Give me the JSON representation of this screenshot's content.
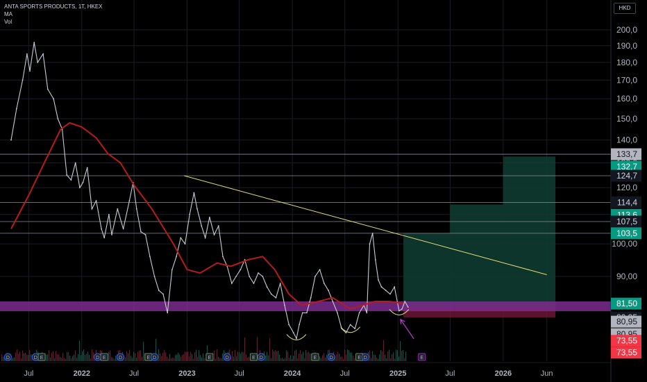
{
  "legend": {
    "symbol": "ANTA SPORTS PRODUCTS, 1T, HKEX",
    "ma": "MA",
    "vol": "Vol"
  },
  "currency_button": "HKD",
  "colors": {
    "background": "#000000",
    "price_line": "#c9cdd6",
    "ma_line": "#b71c1c",
    "trendline": "#e8e07a",
    "purple_band": "#7b2d8e",
    "pink_band": "#7a1a3a",
    "target_box": "#0f3b30",
    "grid": "#1c1e24",
    "up_tag": "#089981",
    "down_tag": "#f23645",
    "gray_tag": "#b2b5be",
    "arrow": "#c23cdb"
  },
  "chart_data": {
    "type": "line",
    "title": "ANTA SPORTS PRODUCTS, 1T, HKEX",
    "y_axis": {
      "scale": "log",
      "ticks": [
        90.0,
        100.0,
        110.0,
        120.0,
        130.0,
        140.0,
        150.0,
        160.0,
        170.0,
        180.0,
        190.0,
        200.0
      ],
      "tick_labels": [
        "90,00",
        "100,00",
        "110,0",
        "120,0",
        "130,0",
        "140,0",
        "150,0",
        "160,0",
        "170,0",
        "180,0",
        "190,0",
        "200,0"
      ]
    },
    "x_axis": {
      "range": [
        "2021-05-01",
        "2026-08-01"
      ],
      "ticks": [
        {
          "date": "2021-07-01",
          "label": "Jul",
          "bold": false
        },
        {
          "date": "2022-01-01",
          "label": "2022",
          "bold": true
        },
        {
          "date": "2022-07-01",
          "label": "Jul",
          "bold": false
        },
        {
          "date": "2023-01-01",
          "label": "2023",
          "bold": true
        },
        {
          "date": "2023-07-01",
          "label": "Jul",
          "bold": false
        },
        {
          "date": "2024-01-01",
          "label": "2024",
          "bold": true
        },
        {
          "date": "2024-07-01",
          "label": "Jul",
          "bold": false
        },
        {
          "date": "2025-01-01",
          "label": "2025",
          "bold": true
        },
        {
          "date": "2025-07-01",
          "label": "Jul",
          "bold": false
        },
        {
          "date": "2026-01-01",
          "label": "2026",
          "bold": true
        },
        {
          "date": "2026-06-01",
          "label": "Jun",
          "bold": false
        }
      ]
    },
    "series": [
      {
        "kind": "price",
        "points": [
          [
            "2021-05-01",
            140
          ],
          [
            "2021-05-20",
            155
          ],
          [
            "2021-06-10",
            170
          ],
          [
            "2021-06-25",
            185
          ],
          [
            "2021-07-05",
            175
          ],
          [
            "2021-07-20",
            192
          ],
          [
            "2021-08-01",
            180
          ],
          [
            "2021-08-20",
            185
          ],
          [
            "2021-09-05",
            165
          ],
          [
            "2021-09-25",
            160
          ],
          [
            "2021-10-10",
            150
          ],
          [
            "2021-10-25",
            145
          ],
          [
            "2021-11-10",
            125
          ],
          [
            "2021-11-25",
            123
          ],
          [
            "2021-12-10",
            130
          ],
          [
            "2021-12-25",
            120
          ],
          [
            "2022-01-05",
            122
          ],
          [
            "2022-01-20",
            128
          ],
          [
            "2022-02-05",
            112
          ],
          [
            "2022-02-20",
            115
          ],
          [
            "2022-03-10",
            105
          ],
          [
            "2022-03-20",
            102
          ],
          [
            "2022-04-05",
            110
          ],
          [
            "2022-04-15",
            103
          ],
          [
            "2022-05-05",
            112
          ],
          [
            "2022-05-25",
            105
          ],
          [
            "2022-06-15",
            115
          ],
          [
            "2022-06-28",
            122
          ],
          [
            "2022-07-10",
            112
          ],
          [
            "2022-07-25",
            104
          ],
          [
            "2022-08-10",
            103
          ],
          [
            "2022-08-25",
            96
          ],
          [
            "2022-09-10",
            90
          ],
          [
            "2022-09-25",
            86
          ],
          [
            "2022-10-10",
            85
          ],
          [
            "2022-10-25",
            80
          ],
          [
            "2022-11-10",
            92
          ],
          [
            "2022-11-25",
            96
          ],
          [
            "2022-12-10",
            102
          ],
          [
            "2022-12-25",
            100
          ],
          [
            "2023-01-10",
            110
          ],
          [
            "2023-01-25",
            118
          ],
          [
            "2023-02-05",
            112
          ],
          [
            "2023-02-20",
            106
          ],
          [
            "2023-03-05",
            102
          ],
          [
            "2023-03-20",
            109
          ],
          [
            "2023-04-05",
            103
          ],
          [
            "2023-04-20",
            106
          ],
          [
            "2023-05-05",
            96
          ],
          [
            "2023-05-20",
            93
          ],
          [
            "2023-06-05",
            88
          ],
          [
            "2023-06-20",
            90
          ],
          [
            "2023-07-05",
            92
          ],
          [
            "2023-07-20",
            95
          ],
          [
            "2023-08-05",
            90
          ],
          [
            "2023-08-20",
            88
          ],
          [
            "2023-09-05",
            91
          ],
          [
            "2023-09-20",
            90
          ],
          [
            "2023-10-05",
            87
          ],
          [
            "2023-10-20",
            85
          ],
          [
            "2023-11-05",
            84
          ],
          [
            "2023-11-20",
            88
          ],
          [
            "2023-12-05",
            82
          ],
          [
            "2023-12-20",
            77
          ],
          [
            "2024-01-05",
            75
          ],
          [
            "2024-01-15",
            73.6
          ],
          [
            "2024-01-25",
            77
          ],
          [
            "2024-02-05",
            80
          ],
          [
            "2024-02-20",
            80
          ],
          [
            "2024-03-05",
            84
          ],
          [
            "2024-03-20",
            90
          ],
          [
            "2024-04-05",
            92
          ],
          [
            "2024-04-20",
            88
          ],
          [
            "2024-05-05",
            86
          ],
          [
            "2024-05-20",
            83
          ],
          [
            "2024-06-05",
            80
          ],
          [
            "2024-06-20",
            76
          ],
          [
            "2024-07-05",
            75
          ],
          [
            "2024-07-20",
            77
          ],
          [
            "2024-08-05",
            76
          ],
          [
            "2024-08-20",
            80
          ],
          [
            "2024-09-05",
            82
          ],
          [
            "2024-09-15",
            80
          ],
          [
            "2024-09-25",
            100
          ],
          [
            "2024-10-05",
            103.5
          ],
          [
            "2024-10-15",
            95
          ],
          [
            "2024-10-25",
            89
          ],
          [
            "2024-11-05",
            87
          ],
          [
            "2024-11-20",
            86
          ],
          [
            "2024-12-05",
            85
          ],
          [
            "2024-12-20",
            87
          ],
          [
            "2025-01-05",
            80.5
          ],
          [
            "2025-01-15",
            81
          ],
          [
            "2025-01-25",
            83
          ],
          [
            "2025-02-05",
            81.5
          ]
        ]
      },
      {
        "kind": "moving_average",
        "name": "MA",
        "points": [
          [
            "2021-05-01",
            105
          ],
          [
            "2021-07-01",
            117
          ],
          [
            "2021-09-01",
            132
          ],
          [
            "2021-10-20",
            145
          ],
          [
            "2021-11-20",
            148
          ],
          [
            "2022-01-01",
            146
          ],
          [
            "2022-02-20",
            141
          ],
          [
            "2022-04-01",
            134
          ],
          [
            "2022-05-15",
            130
          ],
          [
            "2022-07-01",
            121
          ],
          [
            "2022-09-01",
            112
          ],
          [
            "2022-11-15",
            100
          ],
          [
            "2023-01-01",
            92
          ],
          [
            "2023-02-15",
            91
          ],
          [
            "2023-04-15",
            94
          ],
          [
            "2023-06-01",
            93
          ],
          [
            "2023-08-01",
            95
          ],
          [
            "2023-09-20",
            96
          ],
          [
            "2023-11-01",
            92
          ],
          [
            "2023-12-20",
            85
          ],
          [
            "2024-02-01",
            82
          ],
          [
            "2024-04-01",
            83
          ],
          [
            "2024-05-20",
            84
          ],
          [
            "2024-07-20",
            81
          ],
          [
            "2024-09-01",
            82
          ],
          [
            "2024-10-15",
            83
          ],
          [
            "2024-12-01",
            83
          ],
          [
            "2025-01-20",
            82.5
          ]
        ]
      }
    ],
    "horizontal_levels": [
      133.7,
      124.7,
      114.4,
      107.5,
      103.5
    ],
    "trendline": {
      "from": [
        "2022-12-22",
        124.7
      ],
      "to": [
        "2026-06-01",
        90.5
      ]
    },
    "purple_zone": {
      "from": 80.4,
      "to": 83.0
    },
    "target_boxes": [
      {
        "from": "2025-01-20",
        "to": "2025-07-01",
        "low": 81.5,
        "high": 103.5
      },
      {
        "from": "2025-07-01",
        "to": "2026-01-01",
        "low": 81.5,
        "high": 113.6
      },
      {
        "from": "2026-01-01",
        "to": "2026-07-01",
        "low": 81.5,
        "high": 132.7
      }
    ],
    "stop_zone": {
      "from": "2025-01-20",
      "to": "2026-07-01",
      "low": 78.8,
      "high": 81.5
    },
    "patterns": [
      {
        "date": "2024-01-15",
        "value": 73.6
      },
      {
        "date": "2024-07-20",
        "value": 75.4
      },
      {
        "date": "2025-01-05",
        "value": 79.8
      }
    ],
    "arrow": {
      "from": [
        "2025-02-25",
        73.55
      ],
      "to": [
        "2025-01-10",
        78.3
      ]
    },
    "events": [
      {
        "date": "2021-04-20",
        "type": "D"
      },
      {
        "date": "2021-07-25",
        "type": "D"
      },
      {
        "date": "2021-08-15",
        "type": "E"
      },
      {
        "date": "2022-02-25",
        "type": "D"
      },
      {
        "date": "2022-03-20",
        "type": "E"
      },
      {
        "date": "2022-05-15",
        "type": "D"
      },
      {
        "date": "2022-08-20",
        "type": "E"
      },
      {
        "date": "2022-09-10",
        "type": "D"
      },
      {
        "date": "2023-03-20",
        "type": "E"
      },
      {
        "date": "2023-05-20",
        "type": "D"
      },
      {
        "date": "2023-08-20",
        "type": "E"
      },
      {
        "date": "2023-09-15",
        "type": "D"
      },
      {
        "date": "2024-03-20",
        "type": "E"
      },
      {
        "date": "2024-05-15",
        "type": "D"
      },
      {
        "date": "2024-08-20",
        "type": "E"
      },
      {
        "date": "2024-09-10",
        "type": "D"
      },
      {
        "date": "2025-03-25",
        "type": "E",
        "highlight": true
      }
    ],
    "price_tags": [
      {
        "value": 133.7,
        "label": "133,7",
        "style": "gray"
      },
      {
        "value": 132.7,
        "label": "132,7",
        "style": "up"
      },
      {
        "value": 124.7,
        "label": "124,7",
        "style": "dark"
      },
      {
        "value": 114.4,
        "label": "114,4",
        "style": "dark"
      },
      {
        "value": 113.6,
        "label": "113,6",
        "style": "up"
      },
      {
        "value": 107.5,
        "label": "107,5",
        "style": "dark"
      },
      {
        "value": 103.5,
        "label": "103,5",
        "style": "up"
      },
      {
        "value": 81.5,
        "label": "81,50",
        "style": "up"
      },
      {
        "value": 80.95,
        "label": "80,95",
        "style": "dark"
      },
      {
        "value": 80.95,
        "label": "80,95",
        "style": "gray",
        "stack": 1
      },
      {
        "value": 80.95,
        "label": "80,95",
        "style": "gray",
        "stack": 2
      },
      {
        "value": 73.55,
        "label": "73,55",
        "style": "down"
      },
      {
        "value": 73.55,
        "label": "73,55",
        "style": "down",
        "stack": 1
      }
    ]
  }
}
